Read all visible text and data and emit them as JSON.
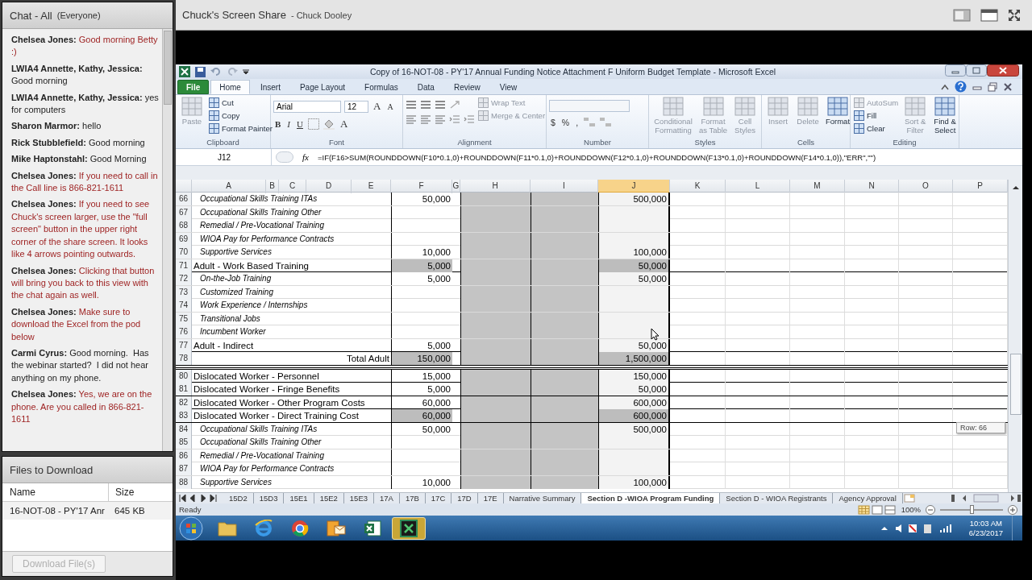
{
  "chat": {
    "title": "Chat - All",
    "audience": "(Everyone)",
    "messages": [
      {
        "sender": "Chelsea Jones:",
        "text": "Good morning Betty :)",
        "host": true
      },
      {
        "sender": "LWIA4 Annette, Kathy, Jessica:",
        "text": "Good morning",
        "host": false
      },
      {
        "sender": "LWIA4 Annette, Kathy, Jessica:",
        "text": "yes for computers",
        "host": false
      },
      {
        "sender": "Sharon Marmor:",
        "text": "hello",
        "host": false
      },
      {
        "sender": "Rick Stubblefield:",
        "text": "Good morning",
        "host": false
      },
      {
        "sender": "Mike Haptonstahl:",
        "text": "Good Morning",
        "host": false
      },
      {
        "sender": "Chelsea Jones:",
        "text": "If you need to call in the Call line is 866-821-1611",
        "host": true
      },
      {
        "sender": "Chelsea Jones:",
        "text": "If you need to see Chuck's screen larger, use the \"full screen\" button in the upper right corner of the share screen. It looks like 4 arrows pointing outwards.",
        "host": true
      },
      {
        "sender": "Chelsea Jones:",
        "text": "Clicking that button will bring you back to this view with the chat again as well.",
        "host": true
      },
      {
        "sender": "Chelsea Jones:",
        "text": "Make sure to download the Excel from the pod below",
        "host": true
      },
      {
        "sender": "Carmi Cyrus:",
        "text": "Good morning.  Has the webinar started?  I did not hear anything on my phone.",
        "host": false
      },
      {
        "sender": "Chelsea Jones:",
        "text": "Yes, we are on the phone. Are you called in 866-821-1611",
        "host": true
      }
    ]
  },
  "files": {
    "title": "Files to Download",
    "columns": [
      "Name",
      "Size"
    ],
    "rows": [
      {
        "name": "16-NOT-08 - PY'17 Anr",
        "size": "645 KB"
      }
    ],
    "button": {
      "label": "Download File(s)",
      "disabled": true
    }
  },
  "share": {
    "title": "Chuck's Screen Share",
    "presenter": "- Chuck Dooley"
  },
  "excel": {
    "title": "Copy of 16-NOT-08 - PY'17 Annual Funding Notice Attachment F Uniform Budget Template  -  Microsoft Excel",
    "tabs": [
      {
        "label": "File",
        "kind": "file",
        "selected": false
      },
      {
        "label": "Home",
        "kind": "tab",
        "selected": true
      },
      {
        "label": "Insert",
        "kind": "tab",
        "selected": false
      },
      {
        "label": "Page Layout",
        "kind": "tab",
        "selected": false
      },
      {
        "label": "Formulas",
        "kind": "tab",
        "selected": false
      },
      {
        "label": "Data",
        "kind": "tab",
        "selected": false
      },
      {
        "label": "Review",
        "kind": "tab",
        "selected": false
      },
      {
        "label": "View",
        "kind": "tab",
        "selected": false
      }
    ],
    "groups": [
      {
        "kind": "buttons",
        "label": "Clipboard",
        "large": [
          {
            "label": "Paste",
            "disabled": true
          }
        ],
        "small": [
          {
            "label": "Cut",
            "disabled": false
          },
          {
            "label": "Copy",
            "disabled": false
          },
          {
            "label": "Format Painter",
            "disabled": false
          }
        ]
      },
      {
        "kind": "font",
        "label": "Font",
        "font": "Arial",
        "size": "12",
        "size_buttons": [
          "A",
          "A"
        ],
        "style_buttons": [
          "B",
          "I",
          "U"
        ],
        "color_button": "A"
      },
      {
        "kind": "alignment",
        "label": "Alignment",
        "small": [
          {
            "label": "Wrap Text",
            "disabled": true
          },
          {
            "label": "Merge & Center",
            "disabled": true
          }
        ]
      },
      {
        "kind": "number",
        "label": "Number",
        "symbols": [
          "$",
          "%",
          ","
        ]
      },
      {
        "kind": "buttons",
        "label": "Styles",
        "large": [
          {
            "label": "Conditional Formatting",
            "disabled": true
          },
          {
            "label": "Format as Table",
            "disabled": true
          },
          {
            "label": "Cell Styles",
            "disabled": true
          }
        ]
      },
      {
        "kind": "buttons",
        "label": "Cells",
        "large": [
          {
            "label": "Insert",
            "disabled": true
          },
          {
            "label": "Delete",
            "disabled": true
          },
          {
            "label": "Format",
            "disabled": false
          }
        ]
      },
      {
        "kind": "buttons",
        "label": "Editing",
        "small": [
          {
            "label": "AutoSum",
            "disabled": true
          },
          {
            "label": "Fill",
            "disabled": false
          },
          {
            "label": "Clear",
            "disabled": false
          }
        ],
        "large": [
          {
            "label": "Sort & Filter",
            "disabled": true
          },
          {
            "label": "Find & Select",
            "disabled": false
          }
        ]
      }
    ],
    "name_box": "J12",
    "function_label": "fx",
    "formula": "=IF(F16>SUM(ROUNDDOWN(F10*0.1,0)+ROUNDDOWN(F11*0.1,0)+ROUNDDOWN(F12*0.1,0)+ROUNDDOWN(F13*0.1,0)+ROUNDDOWN(F14*0.1,0)),\"ERR\",\"\")"
  },
  "sheet": {
    "columns": [
      {
        "label": "A",
        "selected": false
      },
      {
        "label": "B",
        "selected": false
      },
      {
        "label": "C",
        "selected": false
      },
      {
        "label": "D",
        "selected": false
      },
      {
        "label": "E",
        "selected": false
      },
      {
        "label": "F",
        "selected": false
      },
      {
        "label": "G",
        "selected": false
      },
      {
        "label": "H",
        "selected": false
      },
      {
        "label": "I",
        "selected": false
      },
      {
        "label": "J",
        "selected": true
      },
      {
        "label": "K",
        "selected": false
      },
      {
        "label": "L",
        "selected": false
      },
      {
        "label": "M",
        "selected": false
      },
      {
        "label": "N",
        "selected": false
      },
      {
        "label": "O",
        "selected": false
      },
      {
        "label": "P",
        "selected": false
      }
    ],
    "blocks": [
      [
        {
          "row": "66",
          "kind": "item",
          "label": "Occupational Skills Training ITAs",
          "f": "50,000",
          "j": "500,000",
          "shaded": false
        },
        {
          "row": "67",
          "kind": "item",
          "label": "Occupational Skills Training Other",
          "shaded": false
        },
        {
          "row": "68",
          "kind": "item",
          "label": "Remedial / Pre-Vocational Training",
          "shaded": false
        },
        {
          "row": "69",
          "kind": "item",
          "label": "WIOA Pay for Performance Contracts",
          "shaded": false
        },
        {
          "row": "70",
          "kind": "item",
          "label": "Supportive Services",
          "f": "10,000",
          "j": "100,000",
          "shaded": false
        },
        {
          "row": "71",
          "kind": "heading",
          "label": "Adult - Work Based Training",
          "f": "5,000",
          "j": "50,000",
          "shaded": true
        },
        {
          "row": "72",
          "kind": "item",
          "label": "On-the-Job Training",
          "f": "5,000",
          "j": "50,000",
          "shaded": false
        },
        {
          "row": "73",
          "kind": "item",
          "label": "Customized Training",
          "shaded": false
        },
        {
          "row": "74",
          "kind": "item",
          "label": "Work Experience / Internships",
          "shaded": false
        },
        {
          "row": "75",
          "kind": "item",
          "label": "Transitional Jobs",
          "shaded": false
        },
        {
          "row": "76",
          "kind": "item",
          "label": "Incumbent Worker",
          "shaded": false
        },
        {
          "row": "77",
          "kind": "heading",
          "label": "Adult - Indirect",
          "f": "5,000",
          "j": "50,000",
          "shaded": false
        },
        {
          "row": "78",
          "kind": "total",
          "label": "Total Adult",
          "f": "150,000",
          "j": "1,500,000",
          "shaded": true
        }
      ],
      [
        {
          "row": "80",
          "kind": "heading",
          "label": "Dislocated Worker - Personnel",
          "f": "15,000",
          "j": "150,000",
          "shaded": false
        },
        {
          "row": "81",
          "kind": "heading",
          "label": "Dislocated Worker - Fringe Benefits",
          "f": "5,000",
          "j": "50,000",
          "shaded": false
        },
        {
          "row": "82",
          "kind": "heading",
          "label": "Dislocated Worker - Other Program Costs",
          "f": "60,000",
          "j": "600,000",
          "shaded": false
        },
        {
          "row": "83",
          "kind": "heading",
          "label": "Dislocated Worker - Direct Training Cost",
          "f": "60,000",
          "j": "600,000",
          "shaded": true
        },
        {
          "row": "84",
          "kind": "item",
          "label": "Occupational Skills Training ITAs",
          "f": "50,000",
          "j": "500,000",
          "shaded": false
        },
        {
          "row": "85",
          "kind": "item",
          "label": "Occupational Skills Training Other",
          "shaded": false
        },
        {
          "row": "86",
          "kind": "item",
          "label": "Remedial / Pre-Vocational Training",
          "shaded": false
        },
        {
          "row": "87",
          "kind": "item",
          "label": "WIOA Pay for Performance Contracts",
          "shaded": false
        },
        {
          "row": "88",
          "kind": "item",
          "label": "Supportive Services",
          "f": "10,000",
          "j": "100,000",
          "shaded": false
        }
      ]
    ],
    "row_tip": "Row: 66",
    "tabs": [
      {
        "label": "15D2",
        "selected": false
      },
      {
        "label": "15D3",
        "selected": false
      },
      {
        "label": "15E1",
        "selected": false
      },
      {
        "label": "15E2",
        "selected": false
      },
      {
        "label": "15E3",
        "selected": false
      },
      {
        "label": "17A",
        "selected": false
      },
      {
        "label": "17B",
        "selected": false
      },
      {
        "label": "17C",
        "selected": false
      },
      {
        "label": "17D",
        "selected": false
      },
      {
        "label": "17E",
        "selected": false
      },
      {
        "label": "Narrative Summary",
        "selected": false
      },
      {
        "label": "Section D -WIOA Program Funding",
        "selected": true
      },
      {
        "label": "Section D - WIOA Registrants",
        "selected": false
      },
      {
        "label": "Agency Approval",
        "selected": false
      }
    ]
  },
  "status": {
    "text": "Ready",
    "zoom": "100%",
    "zoom_slider": {
      "level": 0.5
    }
  },
  "taskbar": {
    "apps": [
      {
        "kind": "folder",
        "selected": false
      },
      {
        "kind": "browser",
        "selected": false
      },
      {
        "kind": "chrome",
        "selected": false
      },
      {
        "kind": "mail",
        "selected": false
      },
      {
        "kind": "sheet",
        "selected": false
      },
      {
        "kind": "sheet-dark",
        "selected": true
      }
    ],
    "time": "10:03 AM",
    "date": "6/23/2017"
  }
}
